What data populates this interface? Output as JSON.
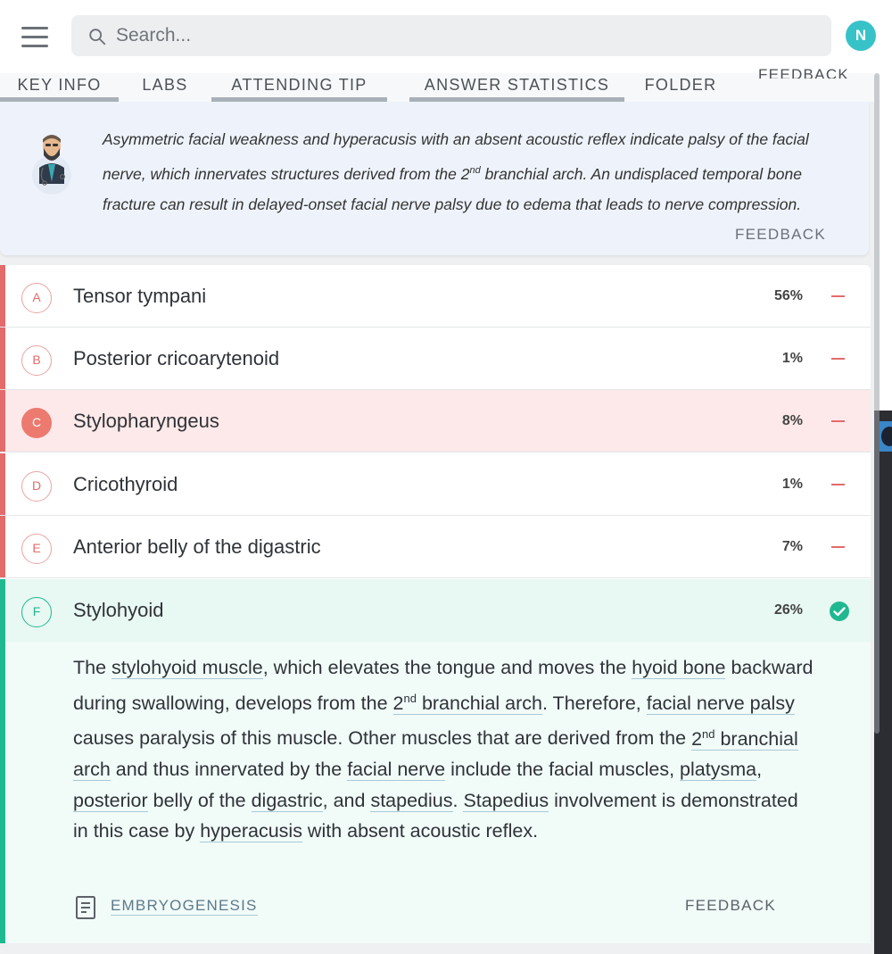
{
  "header": {
    "search_placeholder": "Search...",
    "avatar_initial": "N"
  },
  "tabs": [
    {
      "label": "KEY INFO"
    },
    {
      "label": "LABS"
    },
    {
      "label": "ATTENDING TIP"
    },
    {
      "label": "ANSWER STATISTICS"
    },
    {
      "label": "FOLDER"
    },
    {
      "label": "FEEDBACK"
    }
  ],
  "tip": {
    "line1": "Asymmetric facial weakness and hyperacusis with an absent acoustic reflex indicate palsy of the facial",
    "line2_pre": "nerve, which innervates structures derived from the 2",
    "line2_sup": "nd",
    "line2_post": " branchial arch. An undisplaced temporal bone",
    "line3": "fracture can result in delayed-onset facial nerve palsy due to edema that leads to nerve compression.",
    "feedback": "FEEDBACK"
  },
  "answers": [
    {
      "letter": "A",
      "text": "Tensor tympani",
      "pct": "56%"
    },
    {
      "letter": "B",
      "text": "Posterior cricoarytenoid",
      "pct": "1%"
    },
    {
      "letter": "C",
      "text": "Stylopharyngeus",
      "pct": "8%"
    },
    {
      "letter": "D",
      "text": "Cricothyroid",
      "pct": "1%"
    },
    {
      "letter": "E",
      "text": "Anterior belly of the digastric",
      "pct": "7%"
    },
    {
      "letter": "F",
      "text": "Stylohyoid",
      "pct": "26%"
    }
  ],
  "explanation": {
    "t1": "The ",
    "l1": "stylohyoid muscle",
    "t2": ", which elevates the tongue and moves the ",
    "l2": "hyoid bone",
    "t3": " backward during swallowing, develops from the ",
    "l3a": "2",
    "l3sup": "nd",
    "l3b": " branchial arch",
    "t4": ". Therefore, ",
    "l4": "facial nerve palsy",
    "t5": " causes paralysis of this muscle. Other muscles that are derived from the ",
    "l5a": "2",
    "l5sup": "nd",
    "l5b": " branchial arch",
    "t6": " and thus innervated by the ",
    "l6": "facial nerve",
    "t7": " include the facial muscles, ",
    "l7": "platysma",
    "t8": ", ",
    "l8": "posterior",
    "t9": " belly of the ",
    "l9": "digastric",
    "t10": ", and ",
    "l10": "stapedius",
    "t11": ". ",
    "l11": "Stapedius",
    "t12": " involvement is demonstrated in this case by ",
    "l12": "hyperacusis",
    "t13": " with absent acoustic reflex.",
    "topic": "EMBRYOGENESIS",
    "feedback": "FEEDBACK"
  },
  "colors": {
    "wrong_accent": "#e36b6b",
    "correct_accent": "#20b890",
    "selected_bg": "#fde9e9",
    "correct_bg": "#e8f8f2",
    "avatar": "#37c2c8"
  }
}
